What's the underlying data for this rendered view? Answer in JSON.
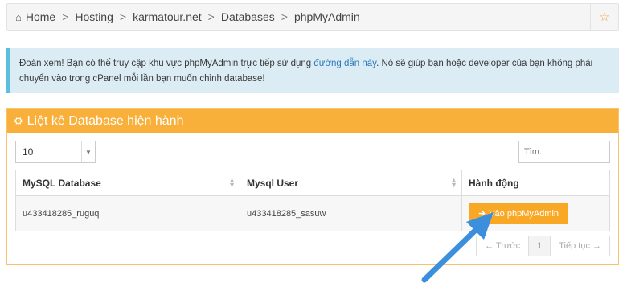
{
  "breadcrumb": {
    "items": [
      "Home",
      "Hosting",
      "karmatour.net",
      "Databases",
      "phpMyAdmin"
    ],
    "home_icon": "home-icon",
    "favorite_icon": "star-icon"
  },
  "alert": {
    "text_before": "Đoán xem! Bạn có thể truy cập khu vực phpMyAdmin trực tiếp sử dụng ",
    "link": "đường dẫn này",
    "text_after": ". Nó sẽ giúp bạn hoặc developer của bạn không phải chuyển vào trong cPanel mỗi lần bạn muốn chỉnh database!"
  },
  "panel": {
    "title": "Liệt kê Database hiện hành",
    "icon": "cogs-icon",
    "page_length": "10",
    "search_placeholder": "Tìm..",
    "columns": [
      "MySQL Database",
      "Mysql User",
      "Hành động"
    ],
    "rows": [
      {
        "database": "u433418285_ruguq",
        "user": "u433418285_sasuw",
        "action": "Vào phpMyAdmin"
      }
    ],
    "pagination": {
      "prev": "← Trước",
      "page": "1",
      "next": "Tiếp tục →"
    }
  },
  "colors": {
    "accent": "#f9b03a",
    "alert_bg": "#dcecf4",
    "alert_border": "#5bc0de",
    "arrow": "#3b8fdc"
  }
}
